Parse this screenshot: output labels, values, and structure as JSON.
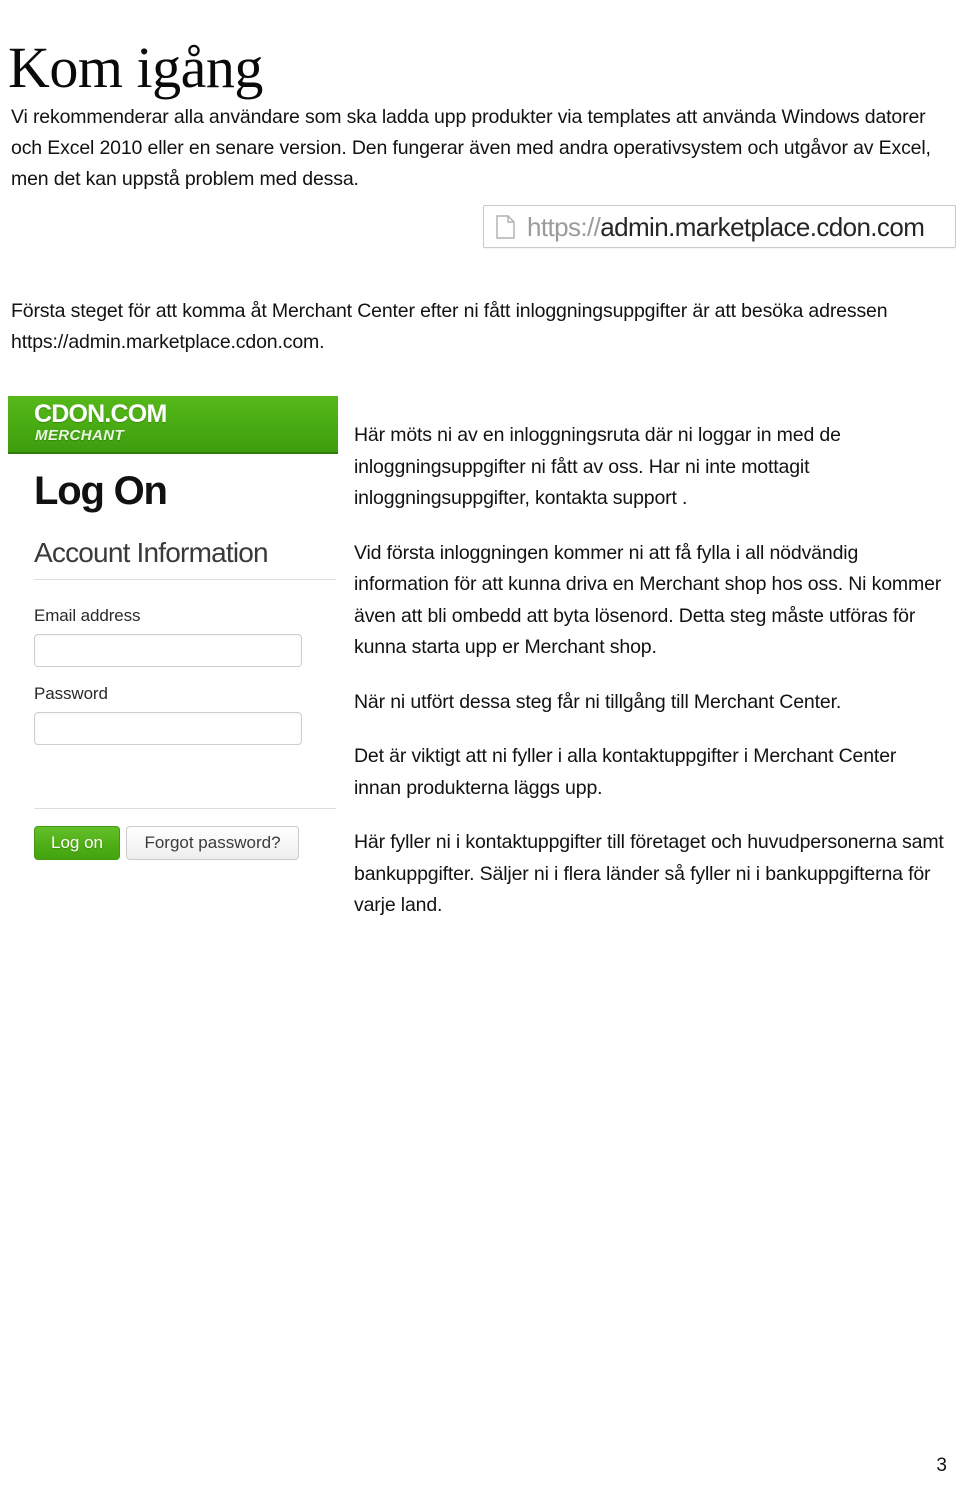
{
  "document": {
    "title": "Kom igång",
    "page_number": "3"
  },
  "intro": {
    "text": "Vi rekommenderar alla användare som ska ladda upp produkter via templates att använda Windows datorer och Excel 2010 eller en senare version. Den fungerar även med andra operativsystem och utgåvor av Excel, men det kan uppstå problem med dessa."
  },
  "urlbar": {
    "icon": "document-icon",
    "scheme": "https://",
    "host": "admin.marketplace.cdon.com",
    "full_url": "https://admin.marketplace.cdon.com"
  },
  "address_paragraph": {
    "text": "Första steget för att komma åt Merchant Center efter ni fått inloggningsuppgifter är att besöka adressen https://admin.marketplace.cdon.com."
  },
  "login_screenshot": {
    "brand": {
      "name": "CDON.COM",
      "subtitle": "MERCHANT",
      "header_color": "#4aae13"
    },
    "heading": "Log On",
    "section_title": "Account Information",
    "fields": [
      {
        "label": "Email address",
        "value": "",
        "placeholder": ""
      },
      {
        "label": "Password",
        "value": "",
        "placeholder": ""
      }
    ],
    "buttons": {
      "primary": "Log on",
      "secondary": "Forgot password?",
      "primary_color": "#4fae16"
    }
  },
  "right_column": {
    "paragraphs": [
      "Här möts ni av en inloggningsruta där ni loggar in med de inloggningsuppgifter ni fått av oss. Har ni inte mottagit inloggningsuppgifter,  kontakta support .",
      "Vid första inloggningen kommer ni att få fylla i all nödvändig information för att kunna driva en Merchant shop hos oss. Ni kommer även att bli ombedd att byta lösenord. Detta steg måste utföras för kunna starta upp er Merchant shop.",
      "När ni utfört dessa steg får ni tillgång till Merchant Center.",
      "Det är viktigt att ni fyller i alla kontaktuppgifter i Merchant Center innan produkterna läggs upp.",
      "Här fyller ni i kontaktuppgifter till företaget och huvudpersonerna samt bankuppgifter. Säljer ni i flera länder så fyller ni i bankuppgifterna för varje land."
    ]
  }
}
